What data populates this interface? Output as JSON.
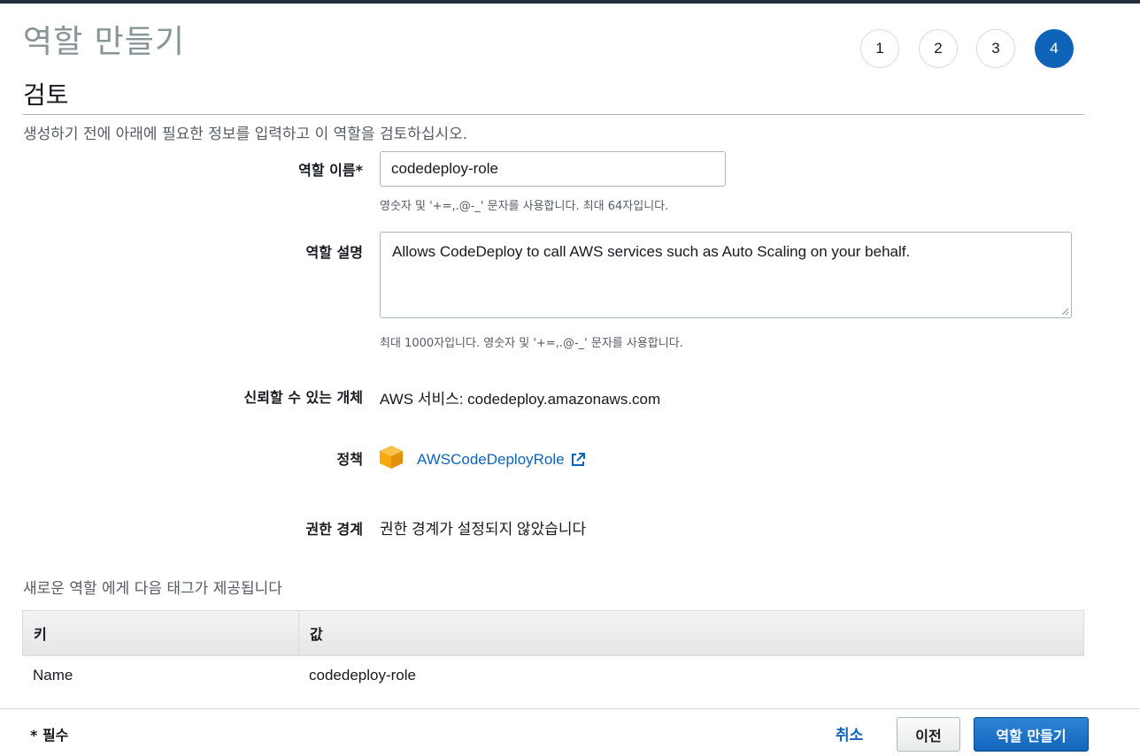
{
  "page": {
    "title": "역할 만들기",
    "steps": [
      "1",
      "2",
      "3",
      "4"
    ],
    "active_step": "4"
  },
  "review": {
    "heading": "검토",
    "intro": "생성하기 전에 아래에 필요한 정보를 입력하고 이 역할을 검토하십시오.",
    "role_name": {
      "label": "역할 이름*",
      "value": "codedeploy-role",
      "hint": "영숫자 및 '+=,.@-_' 문자를 사용합니다. 최대 64자입니다."
    },
    "role_description": {
      "label": "역할 설명",
      "value": "Allows CodeDeploy to call AWS services such as Auto Scaling on your behalf.",
      "hint": "최대 1000자입니다. 영숫자 및 '+=,.@-_' 문자를 사용합니다."
    },
    "trusted_entity": {
      "label": "신뢰할 수 있는 개체",
      "value": "AWS 서비스: codedeploy.amazonaws.com"
    },
    "policy": {
      "label": "정책",
      "link": "AWSCodeDeployRole",
      "icon": "aws-policy-box-icon"
    },
    "permissions_boundary": {
      "label": "권한 경계",
      "value": "권한 경계가 설정되지 않았습니다"
    }
  },
  "tags": {
    "title": "새로운 역할 에게 다음 태그가 제공됩니다",
    "headers": {
      "key": "키",
      "value": "값"
    },
    "rows": [
      {
        "key": "Name",
        "value": "codedeploy-role"
      }
    ]
  },
  "footer": {
    "required_note": "* 필수",
    "cancel": "취소",
    "previous": "이전",
    "create": "역할 만들기"
  },
  "colors": {
    "accent": "#0f64b7",
    "topbar": "#232f3e",
    "policy_icon": "#f7a80d"
  }
}
